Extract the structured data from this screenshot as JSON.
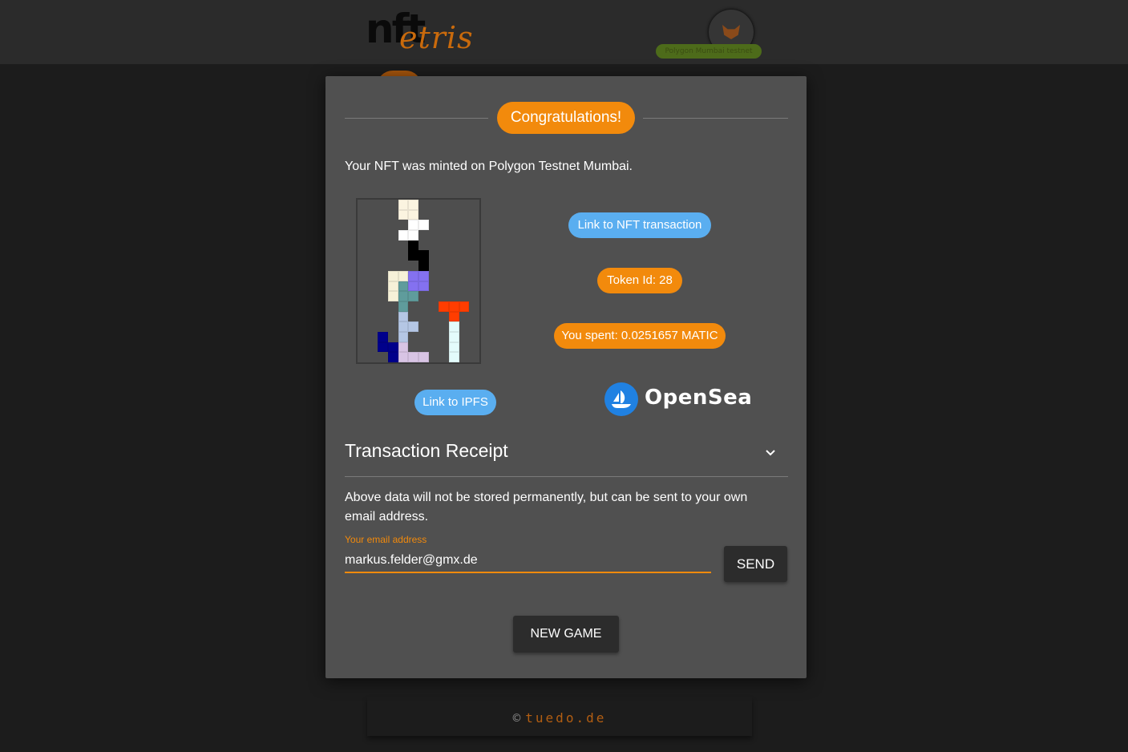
{
  "header": {
    "logo_text_main": "nft",
    "logo_text_sub": "etris",
    "network_chip": "Polygon Mumbai testnet"
  },
  "modal": {
    "title": "Congratulations!",
    "minted_text": "Your NFT was minted on Polygon Testnet Mumbai.",
    "link_transaction": "Link to NFT transaction",
    "token_id": "Token Id: 28",
    "spent": "You spent: 0.0251657 MATIC",
    "link_ipfs": "Link to IPFS",
    "opensea_label": "OpenSea",
    "receipt_title": "Transaction Receipt",
    "info_text": "Above data will not be stored permanently, but can be sent to your own email address.",
    "email_label": "Your email address",
    "email_value": "markus.felder@gmx.de",
    "send_label": "SEND",
    "new_game_label": "NEW GAME"
  },
  "footer": {
    "copyright_symbol": "©",
    "site": "tuedo.de"
  },
  "colors": {
    "accent": "#f28a0c",
    "link_chip": "#5aaef0",
    "modal_bg": "#505050",
    "page_bg": "#1c1c1c",
    "opensea_blue": "#2081e2"
  },
  "board": {
    "columns": 12,
    "rows": 16,
    "filled_cells": [
      {
        "c": 4,
        "r": 0,
        "color": "#fbf4e0"
      },
      {
        "c": 5,
        "r": 0,
        "color": "#fbf4e0"
      },
      {
        "c": 4,
        "r": 1,
        "color": "#fbf4e0"
      },
      {
        "c": 5,
        "r": 1,
        "color": "#fbf4e0"
      },
      {
        "c": 5,
        "r": 2,
        "color": "#ffffff"
      },
      {
        "c": 6,
        "r": 2,
        "color": "#ffffff"
      },
      {
        "c": 4,
        "r": 3,
        "color": "#ffffff"
      },
      {
        "c": 5,
        "r": 3,
        "color": "#ffffff"
      },
      {
        "c": 5,
        "r": 4,
        "color": "#000000"
      },
      {
        "c": 5,
        "r": 5,
        "color": "#000000"
      },
      {
        "c": 6,
        "r": 5,
        "color": "#000000"
      },
      {
        "c": 6,
        "r": 6,
        "color": "#000000"
      },
      {
        "c": 3,
        "r": 7,
        "color": "#f6f1d8"
      },
      {
        "c": 4,
        "r": 7,
        "color": "#f6f1d8"
      },
      {
        "c": 5,
        "r": 7,
        "color": "#8471f0"
      },
      {
        "c": 6,
        "r": 7,
        "color": "#8471f0"
      },
      {
        "c": 3,
        "r": 8,
        "color": "#f6f1d8"
      },
      {
        "c": 4,
        "r": 8,
        "color": "#5f9c9c"
      },
      {
        "c": 5,
        "r": 8,
        "color": "#8471f0"
      },
      {
        "c": 6,
        "r": 8,
        "color": "#8471f0"
      },
      {
        "c": 3,
        "r": 9,
        "color": "#f6f1d8"
      },
      {
        "c": 4,
        "r": 9,
        "color": "#5f9c9c"
      },
      {
        "c": 5,
        "r": 9,
        "color": "#5f9c9c"
      },
      {
        "c": 4,
        "r": 10,
        "color": "#5f9c9c"
      },
      {
        "c": 8,
        "r": 10,
        "color": "#ff3d00"
      },
      {
        "c": 9,
        "r": 10,
        "color": "#ff3d00"
      },
      {
        "c": 10,
        "r": 10,
        "color": "#ff3d00"
      },
      {
        "c": 4,
        "r": 11,
        "color": "#b4c6e4"
      },
      {
        "c": 9,
        "r": 11,
        "color": "#ff3d00"
      },
      {
        "c": 4,
        "r": 12,
        "color": "#b4c6e4"
      },
      {
        "c": 5,
        "r": 12,
        "color": "#b4c6e4"
      },
      {
        "c": 9,
        "r": 12,
        "color": "#e3fbfb"
      },
      {
        "c": 2,
        "r": 13,
        "color": "#00008b"
      },
      {
        "c": 4,
        "r": 13,
        "color": "#b4c6e4"
      },
      {
        "c": 9,
        "r": 13,
        "color": "#e3fbfb"
      },
      {
        "c": 2,
        "r": 14,
        "color": "#00008b"
      },
      {
        "c": 3,
        "r": 14,
        "color": "#00008b"
      },
      {
        "c": 4,
        "r": 14,
        "color": "#d8c4e4"
      },
      {
        "c": 9,
        "r": 14,
        "color": "#e3fbfb"
      },
      {
        "c": 3,
        "r": 15,
        "color": "#00008b"
      },
      {
        "c": 4,
        "r": 15,
        "color": "#d8c4e4"
      },
      {
        "c": 5,
        "r": 15,
        "color": "#d8c4e4"
      },
      {
        "c": 6,
        "r": 15,
        "color": "#d8c4e4"
      },
      {
        "c": 9,
        "r": 15,
        "color": "#e3fbfb"
      }
    ]
  }
}
